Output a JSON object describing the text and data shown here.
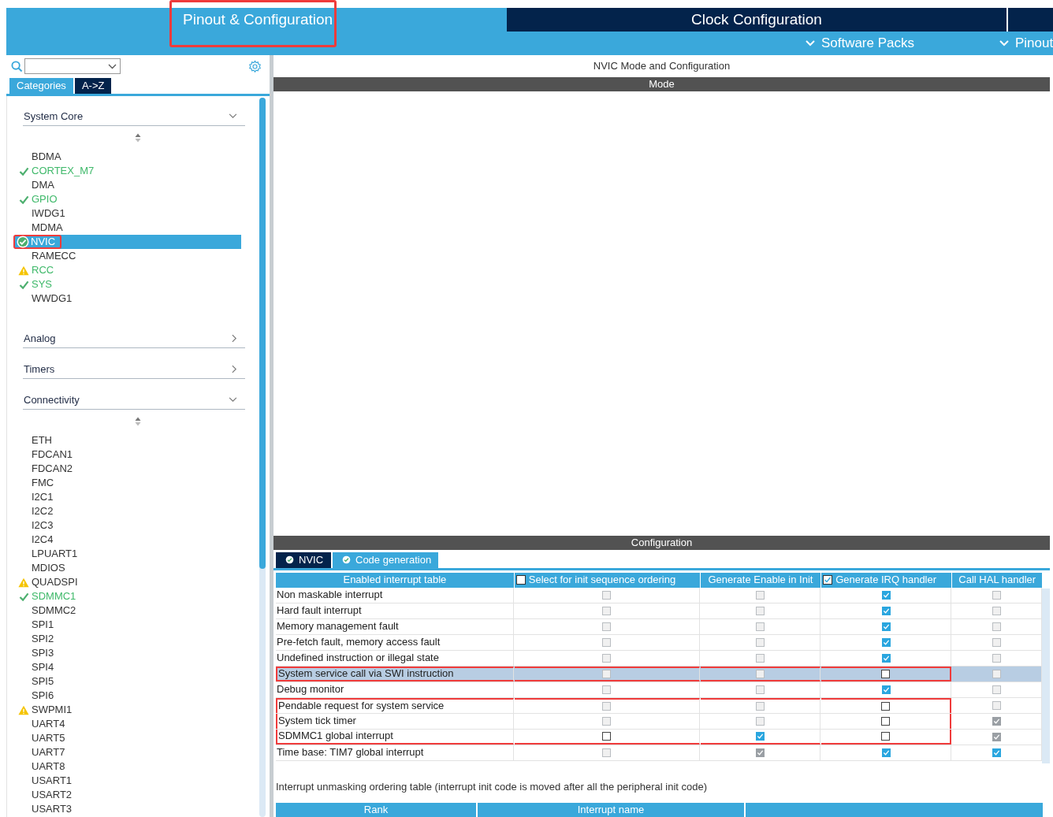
{
  "top_tabs": [
    {
      "label": "Pinout & Configuration",
      "selected": true,
      "marked": true
    },
    {
      "label": "Clock Configuration",
      "selected": false,
      "marked": false
    }
  ],
  "menus": [
    {
      "label": "Software Packs"
    },
    {
      "label": "Pinout"
    }
  ],
  "sidebar": {
    "view_tabs": [
      {
        "label": "Categories",
        "selected": true
      },
      {
        "label": "A->Z",
        "selected": false
      }
    ],
    "categories": [
      {
        "label": "System Core",
        "expanded": true,
        "items": [
          {
            "label": "BDMA",
            "ok": false,
            "warning": false,
            "enabled": false,
            "selected": false,
            "marked": false
          },
          {
            "label": "CORTEX_M7",
            "ok": true,
            "warning": false,
            "enabled": true,
            "selected": false,
            "marked": false
          },
          {
            "label": "DMA",
            "ok": false,
            "warning": false,
            "enabled": false,
            "selected": false,
            "marked": false
          },
          {
            "label": "GPIO",
            "ok": true,
            "warning": false,
            "enabled": true,
            "selected": false,
            "marked": false
          },
          {
            "label": "IWDG1",
            "ok": false,
            "warning": false,
            "enabled": false,
            "selected": false,
            "marked": false
          },
          {
            "label": "MDMA",
            "ok": false,
            "warning": false,
            "enabled": false,
            "selected": false,
            "marked": false
          },
          {
            "label": "NVIC",
            "ok": true,
            "warning": false,
            "selected": true,
            "marked": true
          },
          {
            "label": "RAMECC",
            "ok": false,
            "warning": false,
            "enabled": false,
            "selected": false,
            "marked": false
          },
          {
            "label": "RCC",
            "ok": false,
            "warning": true,
            "enabled": true,
            "selected": false,
            "marked": false
          },
          {
            "label": "SYS",
            "ok": true,
            "warning": false,
            "enabled": true,
            "selected": false,
            "marked": false
          },
          {
            "label": "WWDG1",
            "ok": false,
            "warning": false,
            "enabled": false,
            "selected": false,
            "marked": false
          }
        ]
      },
      {
        "label": "Analog",
        "expanded": false
      },
      {
        "label": "Timers",
        "expanded": false
      },
      {
        "label": "Connectivity",
        "expanded": true,
        "items": [
          {
            "label": "ETH",
            "ok": false,
            "warning": false,
            "enabled": false,
            "selected": false,
            "marked": false
          },
          {
            "label": "FDCAN1",
            "ok": false,
            "warning": false,
            "enabled": false,
            "selected": false,
            "marked": false
          },
          {
            "label": "FDCAN2",
            "ok": false,
            "warning": false,
            "enabled": false,
            "selected": false,
            "marked": false
          },
          {
            "label": "FMC",
            "ok": false,
            "warning": false,
            "enabled": false,
            "selected": false,
            "marked": false
          },
          {
            "label": "I2C1",
            "ok": false,
            "warning": false,
            "enabled": false,
            "selected": false,
            "marked": false
          },
          {
            "label": "I2C2",
            "ok": false,
            "warning": false,
            "enabled": false,
            "selected": false,
            "marked": false
          },
          {
            "label": "I2C3",
            "ok": false,
            "warning": false,
            "enabled": false,
            "selected": false,
            "marked": false
          },
          {
            "label": "I2C4",
            "ok": false,
            "warning": false,
            "enabled": false,
            "selected": false,
            "marked": false
          },
          {
            "label": "LPUART1",
            "ok": false,
            "warning": false,
            "enabled": false,
            "selected": false,
            "marked": false
          },
          {
            "label": "MDIOS",
            "ok": false,
            "warning": false,
            "enabled": false,
            "selected": false,
            "marked": false
          },
          {
            "label": "QUADSPI",
            "ok": false,
            "warning": true,
            "enabled": false,
            "selected": false,
            "marked": false
          },
          {
            "label": "SDMMC1",
            "ok": true,
            "warning": false,
            "enabled": true,
            "selected": false,
            "marked": false
          },
          {
            "label": "SDMMC2",
            "ok": false,
            "warning": false,
            "enabled": false,
            "selected": false,
            "marked": false
          },
          {
            "label": "SPI1",
            "ok": false,
            "warning": false,
            "enabled": false,
            "selected": false,
            "marked": false
          },
          {
            "label": "SPI2",
            "ok": false,
            "warning": false,
            "enabled": false,
            "selected": false,
            "marked": false
          },
          {
            "label": "SPI3",
            "ok": false,
            "warning": false,
            "enabled": false,
            "selected": false,
            "marked": false
          },
          {
            "label": "SPI4",
            "ok": false,
            "warning": false,
            "enabled": false,
            "selected": false,
            "marked": false
          },
          {
            "label": "SPI5",
            "ok": false,
            "warning": false,
            "enabled": false,
            "selected": false,
            "marked": false
          },
          {
            "label": "SPI6",
            "ok": false,
            "warning": false,
            "enabled": false,
            "selected": false,
            "marked": false
          },
          {
            "label": "SWPMI1",
            "ok": false,
            "warning": true,
            "enabled": false,
            "selected": false,
            "marked": false
          },
          {
            "label": "UART4",
            "ok": false,
            "warning": false,
            "enabled": false,
            "selected": false,
            "marked": false
          },
          {
            "label": "UART5",
            "ok": false,
            "warning": false,
            "enabled": false,
            "selected": false,
            "marked": false
          },
          {
            "label": "UART7",
            "ok": false,
            "warning": false,
            "enabled": false,
            "selected": false,
            "marked": false
          },
          {
            "label": "UART8",
            "ok": false,
            "warning": false,
            "enabled": false,
            "selected": false,
            "marked": false
          },
          {
            "label": "USART1",
            "ok": false,
            "warning": false,
            "enabled": false,
            "selected": false,
            "marked": false
          },
          {
            "label": "USART2",
            "ok": false,
            "warning": false,
            "enabled": false,
            "selected": false,
            "marked": false
          },
          {
            "label": "USART3",
            "ok": false,
            "warning": false,
            "enabled": false,
            "selected": false,
            "marked": false
          }
        ]
      }
    ]
  },
  "main": {
    "title": "NVIC Mode and Configuration",
    "mode_header": "Mode",
    "config_header": "Configuration",
    "config_tabs": [
      {
        "label": "NVIC",
        "selected": true
      },
      {
        "label": "Code generation",
        "selected": false
      }
    ],
    "table": {
      "columns": [
        {
          "label": "Enabled interrupt table"
        },
        {
          "label": "Select for init sequence ordering",
          "header_checked": false
        },
        {
          "label": "Generate Enable in Init"
        },
        {
          "label": "Generate IRQ handler",
          "header_checked": true
        },
        {
          "label": "Call HAL handler"
        }
      ],
      "rows": [
        {
          "name": "Non maskable interrupt",
          "selected": false,
          "marked": false,
          "cells": [
            {
              "checked": false,
              "disabled": true
            },
            {
              "checked": false,
              "disabled": true
            },
            {
              "checked": true,
              "disabled": false
            },
            {
              "checked": false,
              "disabled": true
            }
          ]
        },
        {
          "name": "Hard fault interrupt",
          "selected": false,
          "marked": false,
          "cells": [
            {
              "checked": false,
              "disabled": true
            },
            {
              "checked": false,
              "disabled": true
            },
            {
              "checked": true,
              "disabled": false
            },
            {
              "checked": false,
              "disabled": true
            }
          ]
        },
        {
          "name": "Memory management fault",
          "selected": false,
          "marked": false,
          "cells": [
            {
              "checked": false,
              "disabled": true
            },
            {
              "checked": false,
              "disabled": true
            },
            {
              "checked": true,
              "disabled": false
            },
            {
              "checked": false,
              "disabled": true
            }
          ]
        },
        {
          "name": "Pre-fetch fault, memory access fault",
          "selected": false,
          "marked": false,
          "cells": [
            {
              "checked": false,
              "disabled": true
            },
            {
              "checked": false,
              "disabled": true
            },
            {
              "checked": true,
              "disabled": false
            },
            {
              "checked": false,
              "disabled": true
            }
          ]
        },
        {
          "name": "Undefined instruction or illegal state",
          "selected": false,
          "marked": false,
          "cells": [
            {
              "checked": false,
              "disabled": true
            },
            {
              "checked": false,
              "disabled": true
            },
            {
              "checked": true,
              "disabled": false
            },
            {
              "checked": false,
              "disabled": true
            }
          ]
        },
        {
          "name": "System service call via SWI instruction",
          "selected": true,
          "marked": true,
          "cells": [
            {
              "checked": false,
              "disabled": true
            },
            {
              "checked": false,
              "disabled": true
            },
            {
              "checked": false,
              "disabled": false
            },
            {
              "checked": false,
              "disabled": true
            }
          ]
        },
        {
          "name": "Debug monitor",
          "selected": false,
          "marked": false,
          "cells": [
            {
              "checked": false,
              "disabled": true
            },
            {
              "checked": false,
              "disabled": true
            },
            {
              "checked": true,
              "disabled": false
            },
            {
              "checked": false,
              "disabled": true
            }
          ]
        },
        {
          "name": "Pendable request for system service",
          "selected": false,
          "marked": true,
          "cells": [
            {
              "checked": false,
              "disabled": true
            },
            {
              "checked": false,
              "disabled": true
            },
            {
              "checked": false,
              "disabled": false
            },
            {
              "checked": false,
              "disabled": true
            }
          ]
        },
        {
          "name": "System tick timer",
          "selected": false,
          "marked": true,
          "cells": [
            {
              "checked": false,
              "disabled": true
            },
            {
              "checked": false,
              "disabled": true
            },
            {
              "checked": false,
              "disabled": false
            },
            {
              "checked": true,
              "disabled": true
            }
          ]
        },
        {
          "name": "SDMMC1 global interrupt",
          "selected": false,
          "marked": true,
          "cells": [
            {
              "checked": false,
              "disabled": false
            },
            {
              "checked": true,
              "disabled": false
            },
            {
              "checked": false,
              "disabled": false
            },
            {
              "checked": true,
              "disabled": true
            }
          ]
        },
        {
          "name": "Time base: TIM7 global interrupt",
          "selected": false,
          "marked": false,
          "cells": [
            {
              "checked": false,
              "disabled": true
            },
            {
              "checked": true,
              "disabled": true
            },
            {
              "checked": true,
              "disabled": false
            },
            {
              "checked": true,
              "disabled": false
            }
          ]
        }
      ]
    },
    "note": "Interrupt unmasking ordering table (interrupt init code is moved after all the peripheral init code)",
    "order_columns": [
      {
        "label": "Rank"
      },
      {
        "label": "Interrupt name"
      }
    ]
  }
}
